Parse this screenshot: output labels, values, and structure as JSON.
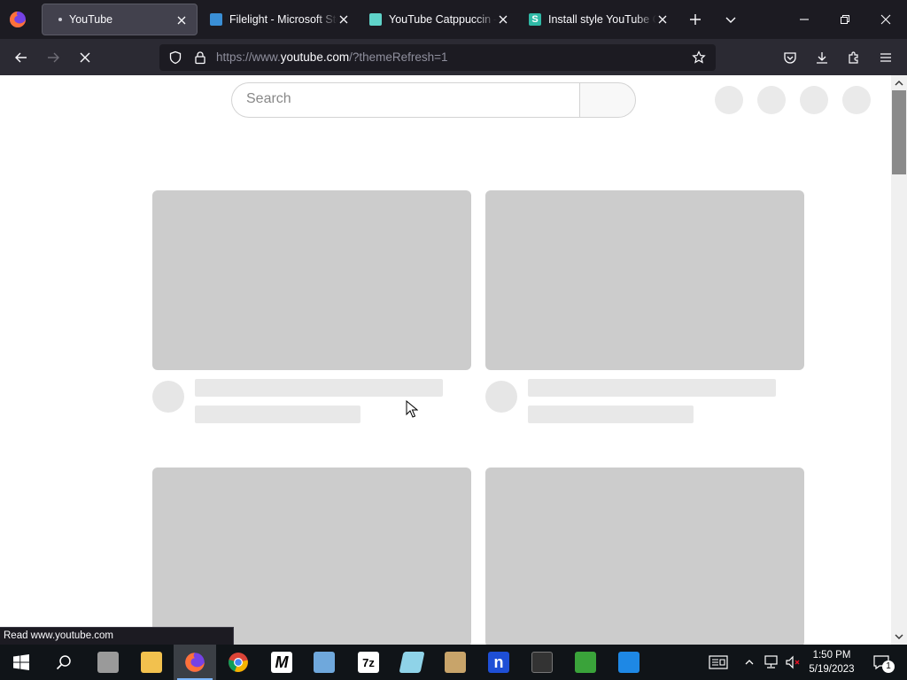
{
  "browser": {
    "tabs": [
      {
        "title": "YouTube",
        "active": true,
        "loading": true
      },
      {
        "title": "Filelight - Microsoft Store",
        "favicon": "microsoft-store-icon",
        "color": "#3a8fd6"
      },
      {
        "title": "YouTube Catppuccin — Userstyles",
        "favicon": "catppuccin-icon",
        "color": "#5fd3c9"
      },
      {
        "title": "Install style YouTube Catppuccin",
        "favicon": "stylus-icon",
        "color": "#2fb9a6"
      }
    ],
    "url": {
      "prefix": "https://www.",
      "host": "youtube.com",
      "path": "/?themeRefresh=1"
    },
    "status_text": "Read www.youtube.com"
  },
  "youtube": {
    "search_placeholder": "Search"
  },
  "taskbar": {
    "apps": [
      {
        "name": "task-manager-app",
        "color": "#9a9a9a"
      },
      {
        "name": "file-explorer-app",
        "color": "#f2c14e"
      },
      {
        "name": "firefox-app",
        "color": "#ff7139",
        "active": true
      },
      {
        "name": "chrome-app",
        "color": "#4285f4"
      },
      {
        "name": "mega-app",
        "label": "M",
        "color": "#ffffff"
      },
      {
        "name": "paint-app",
        "color": "#6fa8dc"
      },
      {
        "name": "7zip-app",
        "label": "7z",
        "color": "#ffffff"
      },
      {
        "name": "notepad-app",
        "color": "#8fd3e8"
      },
      {
        "name": "package-app",
        "color": "#c8a46a"
      },
      {
        "name": "notion-app",
        "label": "n",
        "color": "#1e4fd6"
      },
      {
        "name": "terminal-app",
        "color": "#333333"
      },
      {
        "name": "download-app",
        "color": "#3aa33a"
      },
      {
        "name": "blue-app",
        "color": "#1e88e5"
      }
    ],
    "time": "1:50 PM",
    "date": "5/19/2023",
    "notification_count": "1"
  }
}
